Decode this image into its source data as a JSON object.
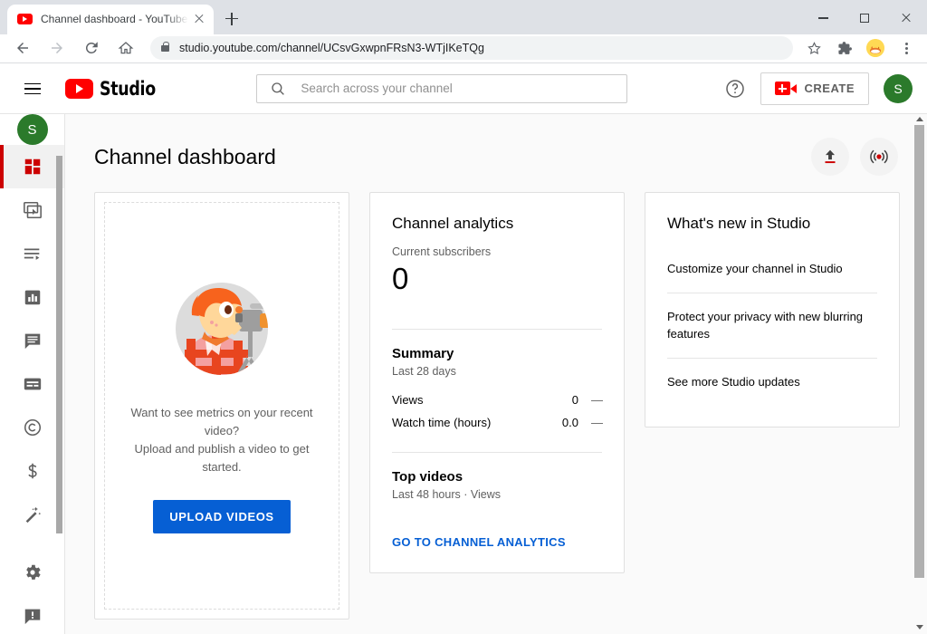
{
  "browser": {
    "tab": {
      "title": "Channel dashboard - YouTube Studio",
      "favicon": "youtube-icon",
      "close": "close-icon"
    },
    "new_tab_label": "+",
    "window_controls": {
      "minimize": "minimize-icon",
      "maximize": "maximize-icon",
      "close": "close-icon"
    },
    "nav": {
      "back": "back-arrow-icon",
      "forward": "forward-arrow-icon",
      "reload": "reload-icon",
      "home": "home-icon"
    },
    "omnibox": {
      "lock": "lock-icon",
      "url_domain": "studio.youtube.com",
      "url_path": "/channel/UCsvGxwpnFRsN3-WTjIKeTQg",
      "url_full": "studio.youtube.com/channel/UCsvGxwpnFRsN3-WTjIKeTQg"
    },
    "toolbar_icons": [
      "bookmark-star-icon",
      "extensions-puzzle-icon",
      "profile-avatar-icon",
      "chrome-menu-icon"
    ]
  },
  "header": {
    "menu_icon": "hamburger-menu-icon",
    "brand_logo": "youtube-logo-icon",
    "brand_text": "Studio",
    "search": {
      "icon": "search-icon",
      "value": "",
      "placeholder": "Search across your channel"
    },
    "help_icon": "help-circle-icon",
    "create": {
      "icon": "video-camera-plus-icon",
      "label": "CREATE"
    },
    "avatar": {
      "initial": "S",
      "color": "#2b7a2b"
    }
  },
  "sidebar": {
    "avatar": {
      "initial": "S",
      "color": "#2b7a2b"
    },
    "items": [
      {
        "name": "dashboard",
        "icon": "dashboard-grid-icon",
        "active": true
      },
      {
        "name": "content",
        "icon": "video-library-icon",
        "active": false
      },
      {
        "name": "playlists",
        "icon": "playlist-icon",
        "active": false
      },
      {
        "name": "analytics",
        "icon": "bar-chart-icon",
        "active": false
      },
      {
        "name": "comments",
        "icon": "comment-bubble-icon",
        "active": false
      },
      {
        "name": "subtitles",
        "icon": "subtitles-icon",
        "active": false
      },
      {
        "name": "copyright",
        "icon": "copyright-icon",
        "active": false
      },
      {
        "name": "monetization",
        "icon": "dollar-sign-icon",
        "active": false
      },
      {
        "name": "customization",
        "icon": "magic-wand-icon",
        "active": false
      }
    ],
    "footer_items": [
      {
        "name": "settings",
        "icon": "gear-icon"
      },
      {
        "name": "send-feedback",
        "icon": "feedback-icon"
      }
    ]
  },
  "page": {
    "title": "Channel dashboard",
    "actions": [
      {
        "name": "upload-video",
        "icon": "upload-arrow-icon"
      },
      {
        "name": "go-live",
        "icon": "live-broadcast-icon"
      }
    ]
  },
  "upload_card": {
    "illustration": "videographer-illustration",
    "text_line1": "Want to see metrics on your recent video?",
    "text_line2": "Upload and publish a video to get started.",
    "button_label": "UPLOAD VIDEOS",
    "button_color": "#065fd4"
  },
  "analytics_card": {
    "title": "Channel analytics",
    "subscribers_label": "Current subscribers",
    "subscribers_value": "0",
    "summary_title": "Summary",
    "summary_period": "Last 28 days",
    "metrics": [
      {
        "label": "Views",
        "value": "0",
        "delta": "—"
      },
      {
        "label": "Watch time (hours)",
        "value": "0.0",
        "delta": "—"
      }
    ],
    "top_videos_title": "Top videos",
    "top_videos_sub": "Last 48 hours · Views",
    "link_label": "GO TO CHANNEL ANALYTICS",
    "link_color": "#065fd4"
  },
  "news_card": {
    "title": "What's new in Studio",
    "items": [
      "Customize your channel in Studio",
      "Protect your privacy with new blurring features",
      "See more Studio updates"
    ]
  }
}
